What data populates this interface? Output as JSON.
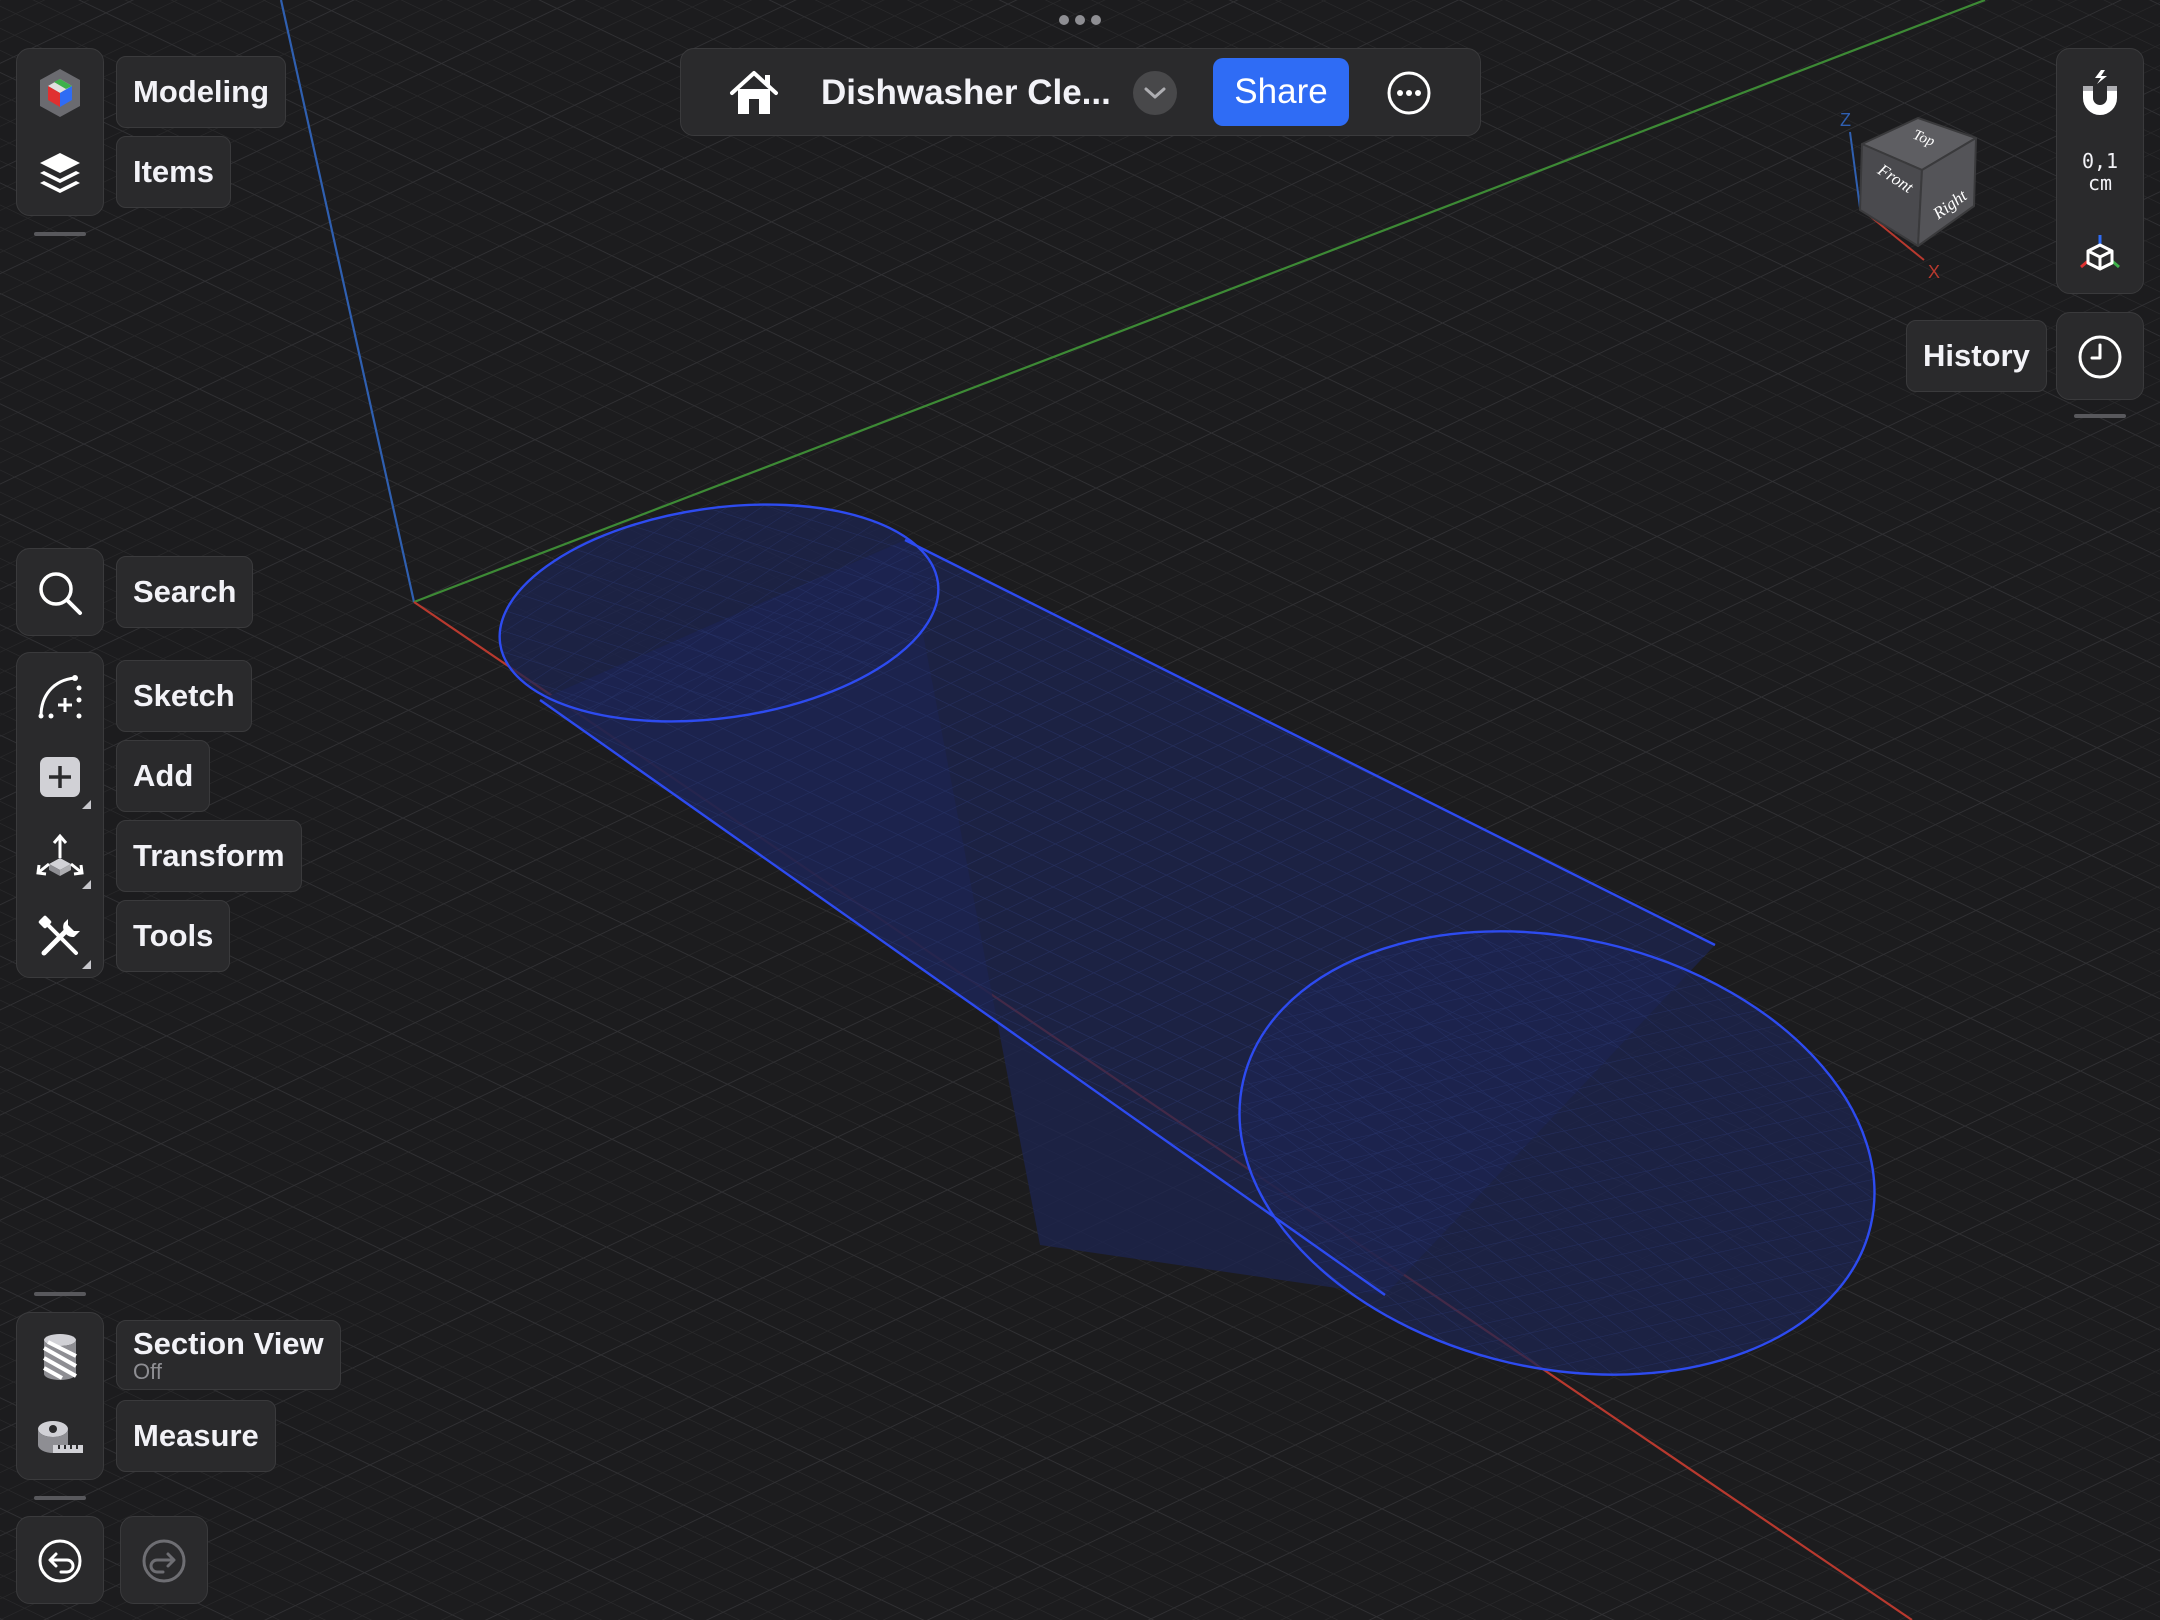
{
  "document": {
    "title": "Dishwasher Cle...",
    "share_label": "Share"
  },
  "left_top": {
    "modeling_label": "Modeling",
    "items_label": "Items"
  },
  "left_tools": {
    "search_label": "Search",
    "sketch_label": "Sketch",
    "add_label": "Add",
    "transform_label": "Transform",
    "tools_label": "Tools"
  },
  "left_bottom": {
    "section_view_label": "Section View",
    "section_view_state": "Off",
    "measure_label": "Measure"
  },
  "right": {
    "snap_value": "0,1",
    "snap_unit": "cm",
    "history_label": "History"
  },
  "view_cube": {
    "top": "Top",
    "front": "Front",
    "right": "Right",
    "axis_z": "Z",
    "axis_x": "X"
  },
  "colors": {
    "accent": "#2f6cf5",
    "axis_x": "#b8392e",
    "axis_y": "#3d8a35",
    "axis_z": "#2f5fb0",
    "shape_stroke": "#2d4bf0",
    "shape_fill": "#1c2450"
  },
  "icons": [
    "home-icon",
    "chevron-down-icon",
    "more-icon",
    "cube-app-icon",
    "layers-icon",
    "search-icon",
    "sketch-icon",
    "add-icon",
    "transform-icon",
    "tools-icon",
    "section-view-icon",
    "measure-icon",
    "undo-icon",
    "redo-icon",
    "magnet-icon",
    "view-mode-icon",
    "history-icon"
  ]
}
